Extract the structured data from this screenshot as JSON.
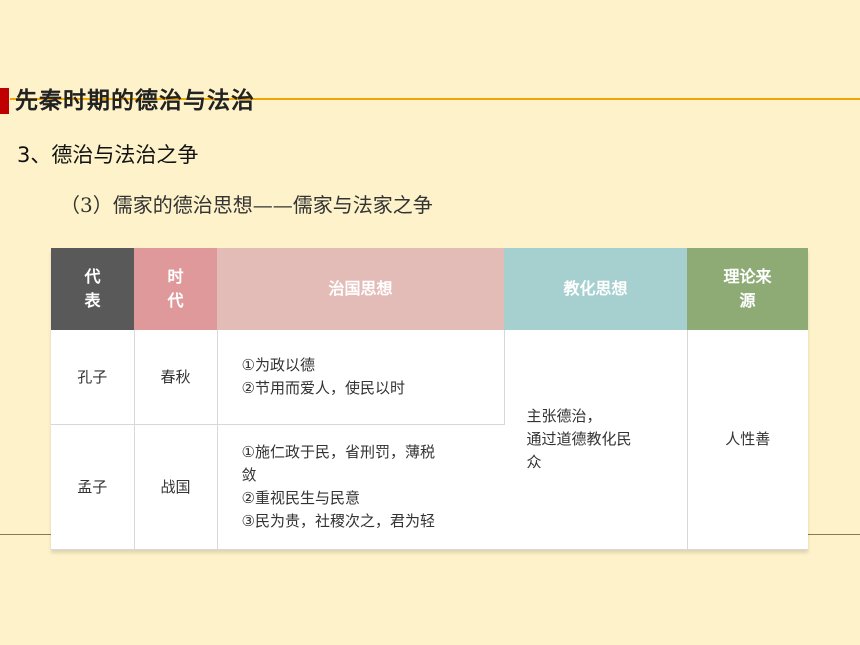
{
  "heading": {
    "title": "先秦时期的德治与法治",
    "subtitle": "3、德治与法治之争",
    "subsub": "（3）儒家的德治思想——儒家与法家之争"
  },
  "table": {
    "headers": {
      "rep": [
        "代",
        "表"
      ],
      "era": [
        "时",
        "代"
      ],
      "governance": "治国思想",
      "education": "教化思想",
      "theory": [
        "理论来",
        "源"
      ]
    },
    "rows": [
      {
        "rep": "孔子",
        "era": "春秋",
        "governance": [
          "①为政以德",
          "②节用而爱人，使民以时"
        ]
      },
      {
        "rep": "孟子",
        "era": "战国",
        "governance": [
          "①施仁政于民，省刑罚，薄税",
          "敛",
          "②重视民生与民意",
          "③民为贵，社稷次之，君为轻"
        ]
      }
    ],
    "education": [
      "主张德治，",
      "通过道德教化民",
      "众"
    ],
    "theory": "人性善"
  },
  "colors": {
    "background": "#fdf2c9",
    "accent_red": "#c00000",
    "accent_line": "#f0a800"
  }
}
